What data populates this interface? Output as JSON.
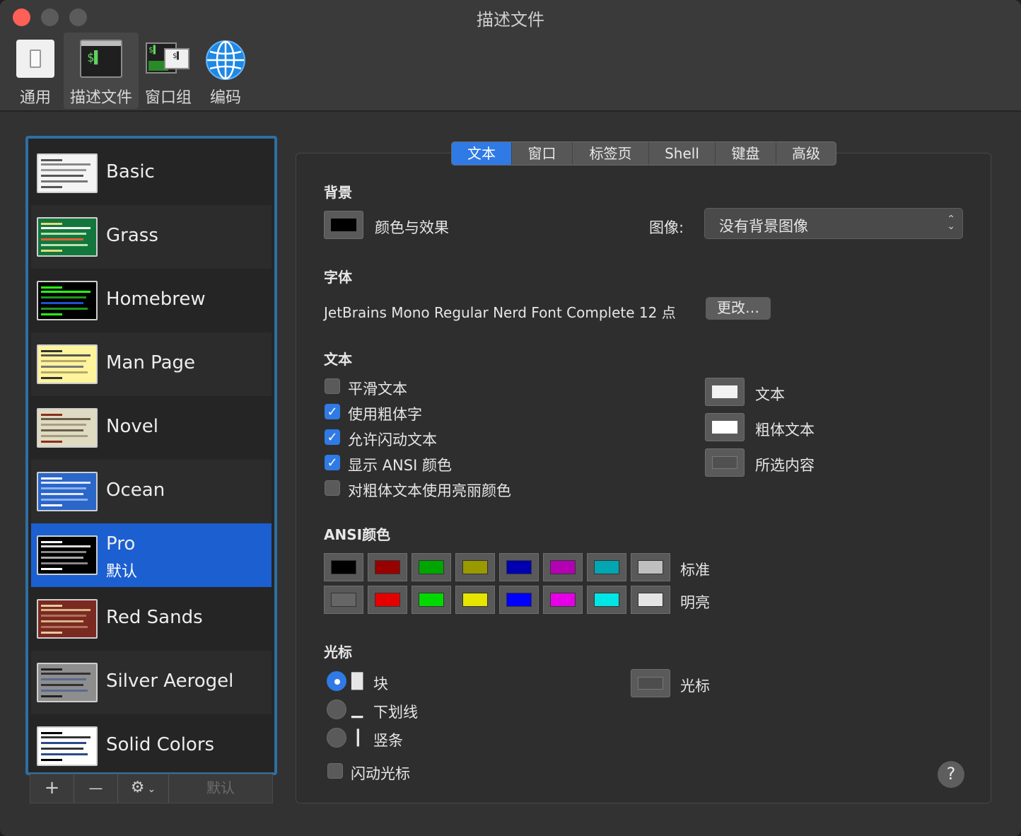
{
  "window": {
    "title": "描述文件"
  },
  "toolbar": [
    {
      "label": "通用",
      "icon": "switch-icon"
    },
    {
      "label": "描述文件",
      "icon": "terminal-icon",
      "active": true
    },
    {
      "label": "窗口组",
      "icon": "window-group-icon"
    },
    {
      "label": "编码",
      "icon": "globe-icon"
    }
  ],
  "profiles": [
    {
      "name": "Basic"
    },
    {
      "name": "Grass"
    },
    {
      "name": "Homebrew"
    },
    {
      "name": "Man Page"
    },
    {
      "name": "Novel"
    },
    {
      "name": "Ocean"
    },
    {
      "name": "Pro",
      "sub": "默认",
      "selected": true
    },
    {
      "name": "Red Sands"
    },
    {
      "name": "Silver Aerogel"
    },
    {
      "name": "Solid Colors"
    }
  ],
  "list_bar": {
    "add": "+",
    "remove": "—",
    "gear": "⚙",
    "default": "默认"
  },
  "tabs": [
    {
      "label": "文本",
      "active": true
    },
    {
      "label": "窗口"
    },
    {
      "label": "标签页"
    },
    {
      "label": "Shell"
    },
    {
      "label": "键盘"
    },
    {
      "label": "高级"
    }
  ],
  "background": {
    "heading": "背景",
    "color_label": "颜色与效果",
    "image_label": "图像:",
    "image_value": "没有背景图像"
  },
  "font": {
    "heading": "字体",
    "value": "JetBrains Mono Regular Nerd Font Complete 12 点",
    "change": "更改…"
  },
  "text": {
    "heading": "文本",
    "options": [
      {
        "label": "平滑文本",
        "checked": false
      },
      {
        "label": "使用粗体字",
        "checked": true
      },
      {
        "label": "允许闪动文本",
        "checked": true
      },
      {
        "label": "显示 ANSI 颜色",
        "checked": true
      },
      {
        "label": "对粗体文本使用亮丽颜色",
        "checked": false
      }
    ],
    "colors": [
      {
        "label": "文本",
        "color": "#f2f2f2"
      },
      {
        "label": "粗体文本",
        "color": "#ffffff"
      },
      {
        "label": "所选内容",
        "color": "#505050"
      }
    ]
  },
  "ansi": {
    "heading": "ANSI颜色",
    "normal_label": "标准",
    "bright_label": "明亮",
    "normal": [
      "#000000",
      "#990000",
      "#00a600",
      "#999900",
      "#0000b2",
      "#b200b2",
      "#00a6b2",
      "#bfbfbf"
    ],
    "bright": [
      "#666666",
      "#e50000",
      "#00d900",
      "#e5e500",
      "#0000ff",
      "#e500e5",
      "#00e5e5",
      "#e5e5e5"
    ]
  },
  "cursor": {
    "heading": "光标",
    "options": [
      {
        "glyph": "█",
        "label": "块",
        "selected": true
      },
      {
        "glyph": "▁",
        "label": "下划线",
        "selected": false
      },
      {
        "glyph": "┃",
        "label": "竖条",
        "selected": false
      }
    ],
    "blink_label": "闪动光标",
    "color_label": "光标",
    "color": "#4d4d4d"
  },
  "help": "?"
}
